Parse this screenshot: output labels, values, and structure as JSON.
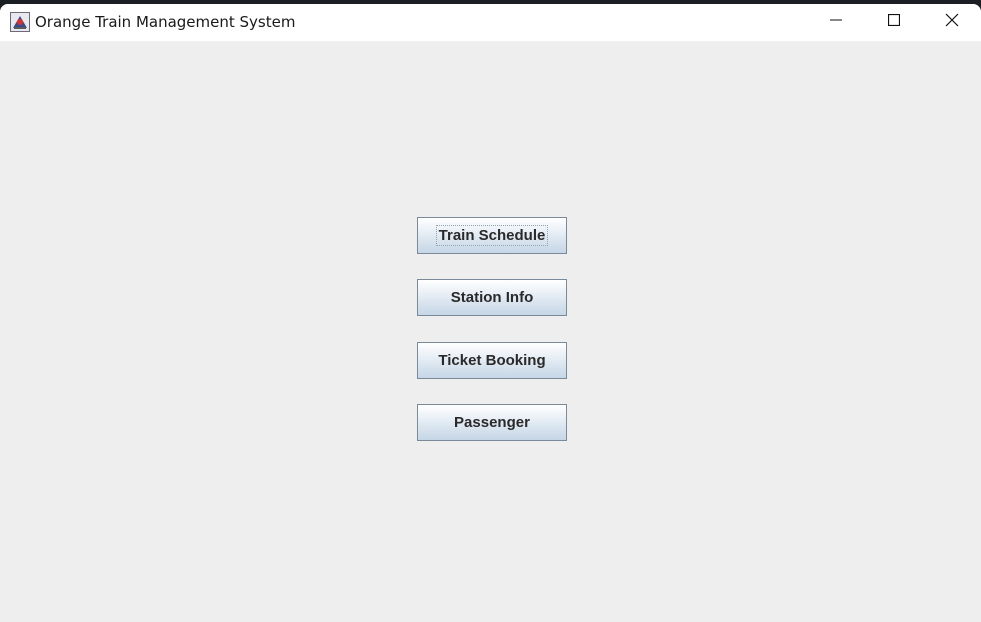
{
  "window": {
    "title": "Orange Train Management System",
    "icon": "java-app-icon"
  },
  "title_controls": {
    "minimize_icon": "minimize-icon",
    "maximize_icon": "maximize-icon",
    "close_icon": "close-icon"
  },
  "menu": {
    "buttons": [
      {
        "label": "Train Schedule",
        "focused": true
      },
      {
        "label": "Station Info"
      },
      {
        "label": "Ticket Booking"
      },
      {
        "label": "Passenger"
      }
    ]
  }
}
